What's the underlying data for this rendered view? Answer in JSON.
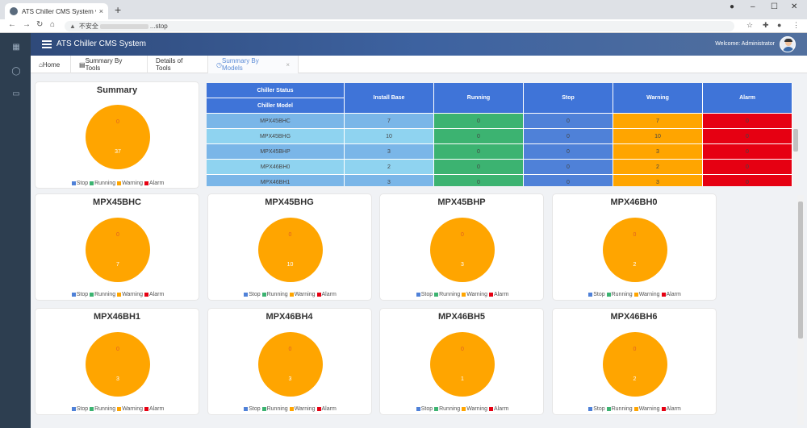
{
  "browser": {
    "tab_title": "ATS Chiller CMS System v1.0",
    "tab_close": "×",
    "new_tab": "+",
    "security_label": "不安全",
    "url_suffix": "...stop",
    "win_minimize": "–",
    "win_maximize": "☐",
    "win_close": "✕"
  },
  "app": {
    "title": "ATS Chiller CMS System",
    "welcome": "Welcome: Administrator"
  },
  "tabs": [
    {
      "label": "Home"
    },
    {
      "label": "Summary By Tools"
    },
    {
      "label": "Details of Tools"
    },
    {
      "label": "Summary By Models",
      "close": "×"
    }
  ],
  "colors": {
    "stop": "#4f81d8",
    "running": "#3cb371",
    "warning": "#ffa500",
    "alarm": "#e60012"
  },
  "legend": [
    "Stop",
    "Running",
    "Warning",
    "Alarm"
  ],
  "summary": {
    "title": "Summary",
    "top_label": "0",
    "bottom_label": "37"
  },
  "table": {
    "header_status": "Chiller Status",
    "header_model": "Chiller Model",
    "columns": [
      "Install Base",
      "Running",
      "Stop",
      "Warning",
      "Alarm"
    ],
    "rows": [
      {
        "model": "MPX45BHC",
        "install": "7",
        "running": "0",
        "stop": "0",
        "warning": "7",
        "alarm": "0"
      },
      {
        "model": "MPX45BHG",
        "install": "10",
        "running": "0",
        "stop": "0",
        "warning": "10",
        "alarm": "0"
      },
      {
        "model": "MPX45BHP",
        "install": "3",
        "running": "0",
        "stop": "0",
        "warning": "3",
        "alarm": "0"
      },
      {
        "model": "MPX46BH0",
        "install": "2",
        "running": "0",
        "stop": "0",
        "warning": "2",
        "alarm": "0"
      },
      {
        "model": "MPX46BH1",
        "install": "3",
        "running": "0",
        "stop": "0",
        "warning": "3",
        "alarm": "0"
      }
    ]
  },
  "models": [
    {
      "title": "MPX45BHC",
      "top": "0",
      "bottom": "7"
    },
    {
      "title": "MPX45BHG",
      "top": "0",
      "bottom": "10"
    },
    {
      "title": "MPX45BHP",
      "top": "0",
      "bottom": "3"
    },
    {
      "title": "MPX46BH0",
      "top": "0",
      "bottom": "2"
    },
    {
      "title": "MPX46BH1",
      "top": "0",
      "bottom": "3"
    },
    {
      "title": "MPX46BH4",
      "top": "0",
      "bottom": "3"
    },
    {
      "title": "MPX46BH5",
      "top": "0",
      "bottom": "1"
    },
    {
      "title": "MPX46BH6",
      "top": "0",
      "bottom": "2"
    }
  ]
}
